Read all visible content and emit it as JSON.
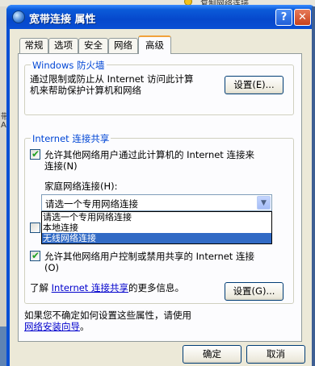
{
  "background": {
    "top_text": "复制网络连接",
    "left_texts": [
      "带",
      "A"
    ]
  },
  "window": {
    "title": "宽带连接 属性",
    "help_label": "?",
    "close_label": "✕"
  },
  "tabs": [
    {
      "label": "常规"
    },
    {
      "label": "选项"
    },
    {
      "label": "安全"
    },
    {
      "label": "网络"
    },
    {
      "label": "高级",
      "active": true
    }
  ],
  "firewall": {
    "title": "Windows 防火墙",
    "desc_line1": "通过限制或防止从 Internet 访问此计算",
    "desc_line2": "机来帮助保护计算机和网络",
    "settings_button": "设置(E)..."
  },
  "ics": {
    "title": "Internet 连接共享",
    "allow_connect_line1": "允许其他网络用户通过此计算机的 Internet 连接来",
    "allow_connect_line2": "连接(N)",
    "allow_connect_checked": true,
    "home_label": "家庭网络连接(H):",
    "combo_value": "请选一个专用网络连接",
    "dropdown_options": [
      "请选一个专用网络连接",
      "本地连接",
      "无线网络连接"
    ],
    "dropdown_selected_index": 2,
    "hidden_checkbox_checked": false,
    "allow_control_line1": "允许其他网络用户控制或禁用共享的 Internet 连接",
    "allow_control_line2": "(O)",
    "allow_control_checked": true,
    "learn_prefix": "了解 ",
    "learn_link": "Internet 连接共享",
    "learn_suffix": "的更多信息。",
    "settings_button": "设置(G)..."
  },
  "footer": {
    "line1": "如果您不确定如何设置这些属性，请使用",
    "wizard_link": "网络安装向导",
    "line2_suffix": "。"
  },
  "buttons": {
    "ok": "确定",
    "cancel": "取消"
  },
  "colors": {
    "titlebar": "#0a4fd4",
    "group_title": "#0046d5",
    "tab_highlight": "#f1a23b",
    "selection": "#316ac5"
  }
}
